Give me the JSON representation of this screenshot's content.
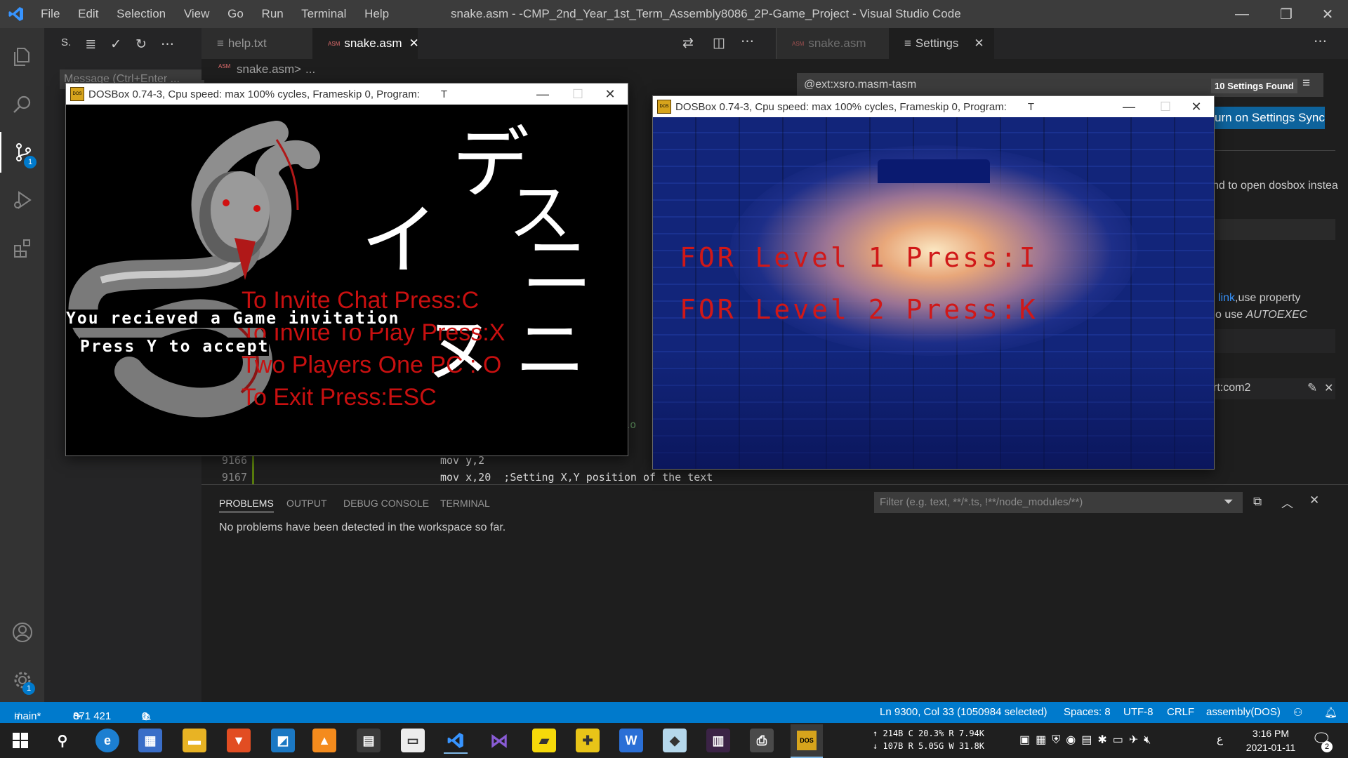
{
  "titlebar": {
    "menu": [
      "File",
      "Edit",
      "Selection",
      "View",
      "Go",
      "Run",
      "Terminal",
      "Help"
    ],
    "title": "snake.asm - -CMP_2nd_Year_1st_Term_Assembly8086_2P-Game_Project - Visual Studio Code",
    "minimize": "—",
    "restore": "❐",
    "close": "✕"
  },
  "activity": {
    "icons": [
      "files-icon",
      "search-icon",
      "source-control-icon",
      "run-debug-icon",
      "extensions-icon",
      "account-icon",
      "manage-gear-icon"
    ],
    "source_control_badge": "1",
    "manage_badge": "1"
  },
  "sidebar": {
    "header_letter": "S.",
    "message_placeholder": "Message (Ctrl+Enter ..."
  },
  "editor_left": {
    "tabs": [
      {
        "label": "help.txt",
        "icon": "≡",
        "active": false
      },
      {
        "label": "snake.asm",
        "icon": "ASM",
        "active": true
      }
    ],
    "breadcrumb_file": "snake.asm",
    "breadcrumb_sep": ">",
    "breadcrumb_more": "...",
    "partial_text": "itio",
    "code": [
      {
        "line": "9166",
        "text": "mov y,2"
      },
      {
        "line": "9167",
        "text": "mov x,20  ;Setting X,Y position of the text"
      }
    ]
  },
  "editor_right": {
    "tabs": [
      {
        "label": "snake.asm",
        "icon": "ASM",
        "active": false
      },
      {
        "label": "Settings",
        "icon": "≡",
        "active": true
      }
    ],
    "search_value": "@ext:xsro.masm-tasm",
    "found_count": "10 Settings Found",
    "sync_button": "urn on Settings Sync",
    "text1": "nd to open dosbox instea",
    "link_text": "link",
    "text2": ",use property",
    "text3": "o use ",
    "text3_em": "AUTOEXEC",
    "item_value": "rt:com2"
  },
  "panel": {
    "tabs": [
      "PROBLEMS",
      "OUTPUT",
      "DEBUG CONSOLE",
      "TERMINAL"
    ],
    "active_tab": "PROBLEMS",
    "filter_placeholder": "Filter (e.g. text, **/*.ts, !**/node_modules/**)",
    "message": "No problems have been detected in the workspace so far."
  },
  "statusbar": {
    "branch": "main*",
    "sync": "871 421",
    "errors": "0",
    "warnings": "0",
    "cursor": "Ln 9300, Col 33 (1050984 selected)",
    "spaces": "Spaces: 8",
    "encoding": "UTF-8",
    "eol": "CRLF",
    "language": "assembly(DOS)"
  },
  "dosbox1": {
    "title": "DOSBox 0.74-3, Cpu speed: max 100% cycles, Frameskip  0, Program:",
    "program": "T",
    "kana": [
      "デ",
      "ス",
      "イ",
      "ニ",
      "ヌ",
      "ニ"
    ],
    "menu_lines": [
      "To Invite Chat Press:C",
      "To Invite To Play Press:X",
      "Two Players One PC : O",
      "To Exit Press:ESC"
    ],
    "notice_line1": "You recieved a Game invitation",
    "notice_line2": "Press Y to accept"
  },
  "dosbox2": {
    "title": "DOSBox 0.74-3, Cpu speed: max 100% cycles, Frameskip  0, Program:",
    "program": "T",
    "level1": "FOR Level 1 Press:I",
    "level2": "FOR Level 2 Press:K"
  },
  "taskbar": {
    "net_up_label": "↑",
    "net_up": "214B",
    "net_down_label": "↓",
    "net_down": "107B",
    "cpu": "C 20.3%",
    "ram": "R 5.05G",
    "disk_read": "R 7.94K",
    "disk_write": "W 31.8K",
    "time": "3:16 PM",
    "date": "2021-01-11",
    "lang": "ع",
    "notif_count": "2"
  },
  "colors": {
    "vscode_blue": "#007acc",
    "activity_bg": "#333333",
    "editor_bg": "#1e1e1e",
    "dos_red": "#c81010"
  }
}
